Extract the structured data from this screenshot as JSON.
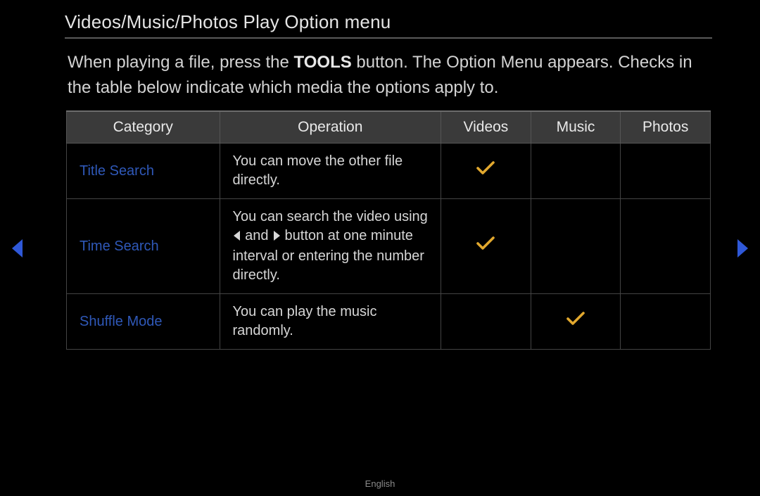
{
  "title": "Videos/Music/Photos Play Option menu",
  "intro": {
    "pre": "When playing a file, press the ",
    "bold": "TOOLS",
    "post": " button. The Option Menu appears. Checks in the table below indicate which media the options apply to."
  },
  "table": {
    "headers": {
      "category": "Category",
      "operation": "Operation",
      "videos": "Videos",
      "music": "Music",
      "photos": "Photos"
    },
    "rows": [
      {
        "category": "Title Search",
        "operation_pre": "You can move the other file directly.",
        "has_inline_icons": false,
        "videos": true,
        "music": false,
        "photos": false
      },
      {
        "category": "Time Search",
        "operation_pre": "You can search the video using ",
        "operation_mid": " and ",
        "operation_post": " button at one minute interval or entering the number directly.",
        "has_inline_icons": true,
        "videos": true,
        "music": false,
        "photos": false
      },
      {
        "category": "Shuffle Mode",
        "operation_pre": "You can play the music randomly.",
        "has_inline_icons": false,
        "videos": false,
        "music": true,
        "photos": false
      }
    ]
  },
  "footer_language": "English"
}
